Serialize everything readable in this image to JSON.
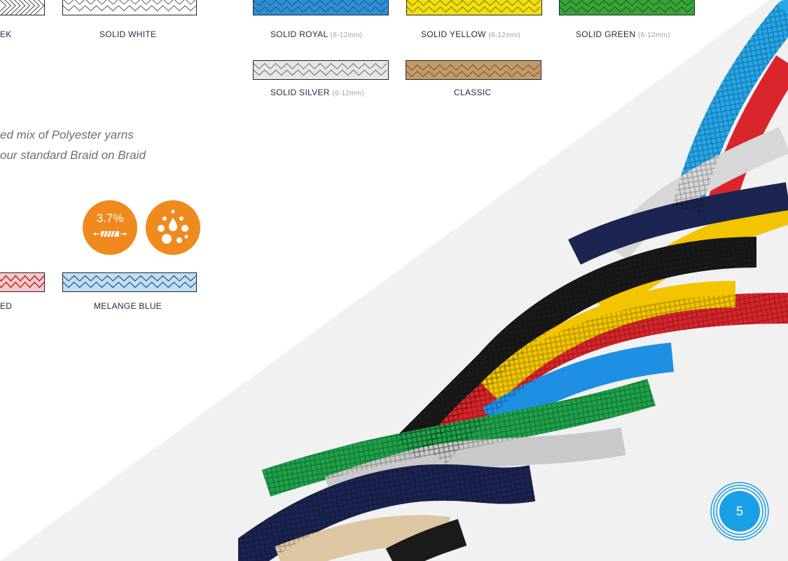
{
  "colors": {
    "accent_orange": "#f08a1f",
    "page_circle": "#1aa0e6",
    "label_text": "#1f2a44",
    "range_text": "#9aa3b2"
  },
  "swatches": [
    {
      "label": "EK",
      "range": "",
      "color": "#ffffff"
    },
    {
      "label": "SOLID WHITE",
      "range": "",
      "color": "#ffffff"
    },
    {
      "label": "SOLID ROYAL",
      "range": "(6-12mm)",
      "color": "#2f8fd6"
    },
    {
      "label": "SOLID YELLOW",
      "range": "(6-12mm)",
      "color": "#f2df0e"
    },
    {
      "label": "SOLID GREEN",
      "range": "(6-12mm)",
      "color": "#37a43a"
    },
    {
      "label": "SOLID SILVER",
      "range": "(6-12mm)",
      "color": "#cfcfcf"
    },
    {
      "label": "CLASSIC",
      "range": "",
      "color": "#c49a6a"
    },
    {
      "label": "ED",
      "range": "",
      "color": "#c0272d"
    },
    {
      "label": "MELANGE BLUE",
      "range": "",
      "color": "#8fc3e6"
    }
  ],
  "description": {
    "line1": "ed mix of Polyester yarns",
    "line2": "our standard Braid on Braid"
  },
  "badges": {
    "stretch_value": "3.7%",
    "stretch_icon": "stretch-rope-icon",
    "water_icon": "water-drops-icon"
  },
  "page_number": "5"
}
